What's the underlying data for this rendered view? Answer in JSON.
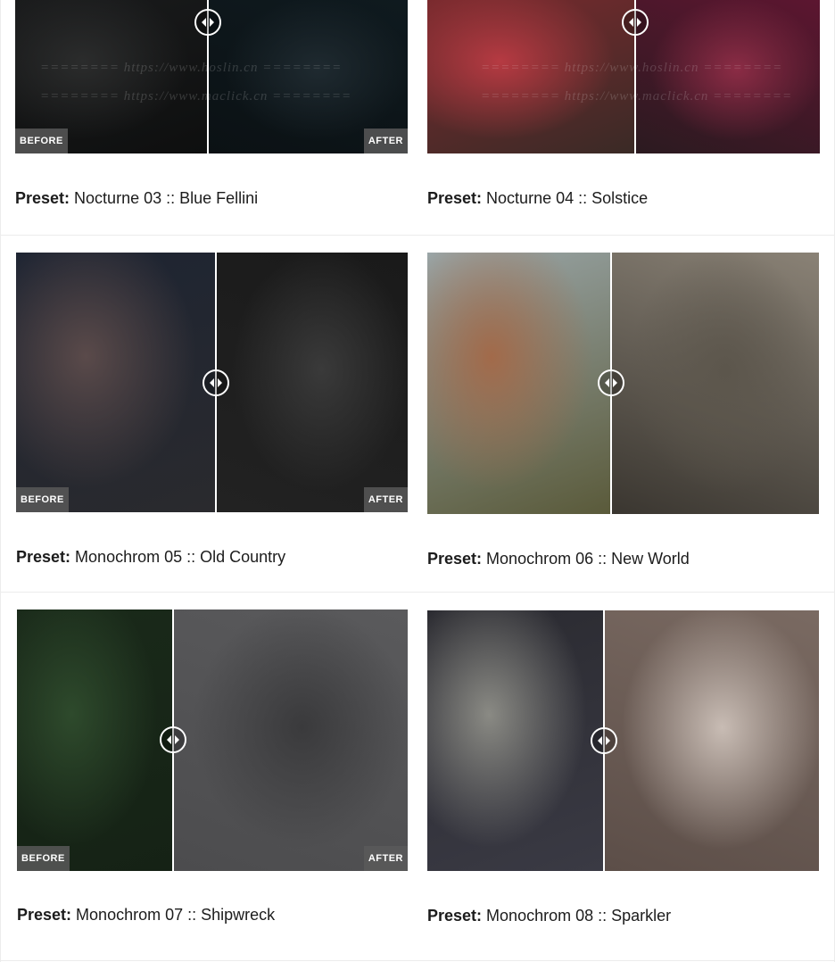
{
  "labels": {
    "before": "BEFORE",
    "after": "AFTER",
    "preset_prefix": "Preset:"
  },
  "watermark": {
    "line1": "======== https://www.hoslin.cn ========",
    "line2": "======== https://www.maclick.cn ========"
  },
  "presets": [
    {
      "name": "Nocturne 03 :: Blue Fellini",
      "handle_pos": 0.49,
      "show_tags": true,
      "before_colors": [
        "#1a1b1c",
        "#2b2c2c",
        "#0e0f0f"
      ],
      "after_colors": [
        "#0f1a1f",
        "#1f2a30",
        "#0b1114"
      ]
    },
    {
      "name": "Nocturne 04 :: Solstice",
      "handle_pos": 0.53,
      "show_tags": false,
      "before_colors": [
        "#7a2a2e",
        "#b63a42",
        "#3a2a26"
      ],
      "after_colors": [
        "#5c1630",
        "#8b2c45",
        "#2b1a20"
      ]
    },
    {
      "name": "Monochrom 05 :: Old Country",
      "handle_pos": 0.51,
      "show_tags": true,
      "before_colors": [
        "#1d2432",
        "#5a4a4a",
        "#2a2a2e"
      ],
      "after_colors": [
        "#1a1a1a",
        "#3a3a3a",
        "#222222"
      ]
    },
    {
      "name": "Monochrom 06 :: New World",
      "handle_pos": 0.47,
      "show_tags": false,
      "before_colors": [
        "#9aa6a8",
        "#a26a4a",
        "#5a5a3a"
      ],
      "after_colors": [
        "#8a8276",
        "#5c564c",
        "#3a3630"
      ]
    },
    {
      "name": "Monochrom 07 :: Shipwreck",
      "handle_pos": 0.4,
      "show_tags": true,
      "before_colors": [
        "#1a2a1a",
        "#2e4a2c",
        "#152215"
      ],
      "after_colors": [
        "#5a5a5c",
        "#3a3a3c",
        "#4c4c4e"
      ]
    },
    {
      "name": "Monochrom 08 :: Sparkler",
      "handle_pos": 0.45,
      "show_tags": false,
      "before_colors": [
        "#2a2a30",
        "#8a8a84",
        "#3a3a44"
      ],
      "after_colors": [
        "#7a6a62",
        "#c8bcb4",
        "#5c4e48"
      ]
    }
  ]
}
